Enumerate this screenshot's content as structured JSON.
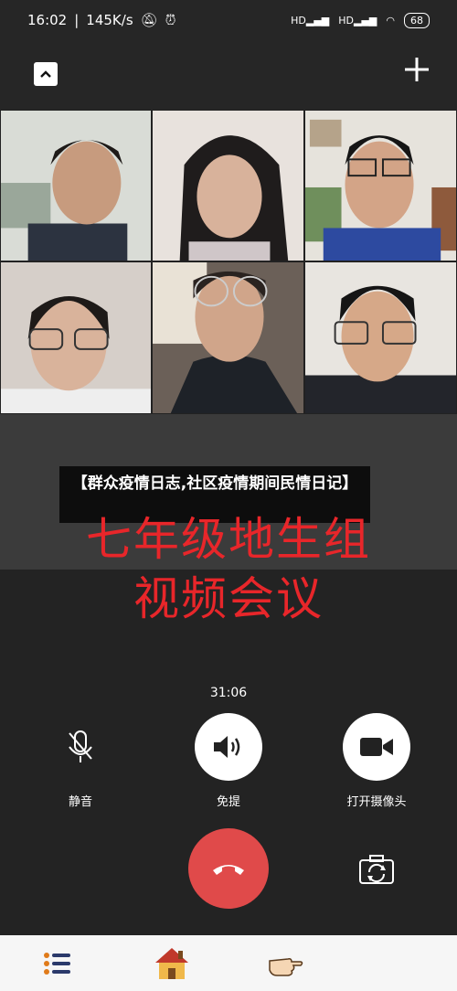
{
  "status_bar": {
    "time": "16:02",
    "speed": "145K/s",
    "network": "HD",
    "battery": "68"
  },
  "banner": {
    "text": "【群众疫情日志,社区疫情期间民情日记】"
  },
  "shared_screen": {
    "line1": "七年级地生组",
    "line2": "视频会议"
  },
  "call": {
    "timer": "31:06",
    "mute_label": "静音",
    "speaker_label": "免提",
    "camera_label": "打开摄像头"
  },
  "colors": {
    "hangup": "#e04a4a",
    "accent_text": "#e8262a"
  }
}
